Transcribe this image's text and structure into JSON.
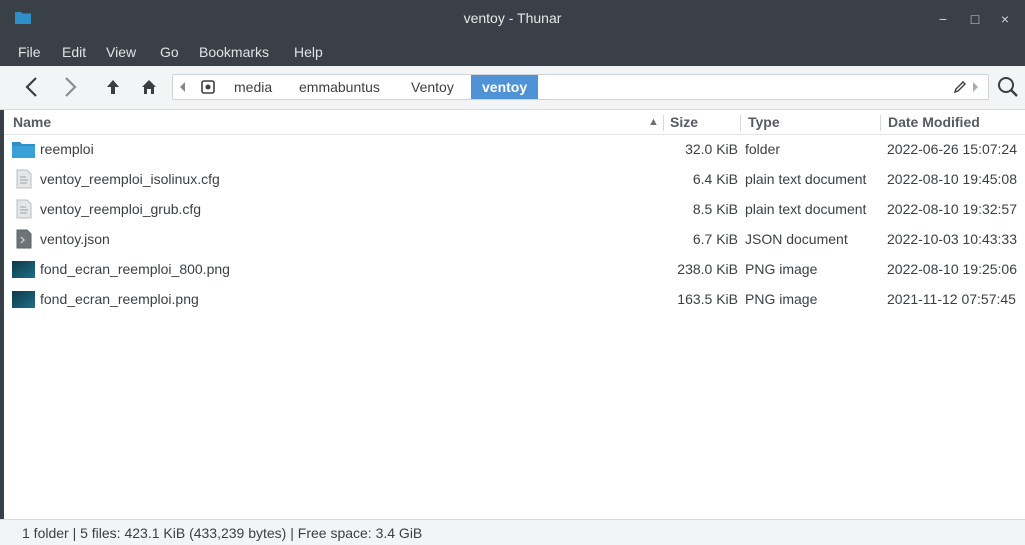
{
  "window": {
    "title": "ventoy - Thunar",
    "minimize_glyph": "−",
    "maximize_glyph": "□",
    "close_glyph": "×"
  },
  "menu": [
    "File",
    "Edit",
    "View",
    "Go",
    "Bookmarks",
    "Help"
  ],
  "toolbar": {
    "icons": [
      "back-arrow-icon",
      "forward-arrow-icon",
      "up-arrow-icon",
      "home-icon",
      "edit-pencil-icon",
      "search-icon"
    ],
    "breadcrumbs": [
      "media",
      "emmabuntus",
      "Ventoy",
      "ventoy"
    ],
    "active_crumb": "ventoy"
  },
  "columns": {
    "name": "Name",
    "size": "Size",
    "type": "Type",
    "date": "Date Modified",
    "sort_indicator": "▲"
  },
  "files": [
    {
      "name": "reemploi",
      "size": "32.0 KiB",
      "type": "folder",
      "date": "2022-06-26 15:07:24",
      "icon": "folder-icon"
    },
    {
      "name": "ventoy_reemploi_isolinux.cfg",
      "size": "6.4 KiB",
      "type": "plain text document",
      "date": "2022-08-10 19:45:08",
      "icon": "text-file-icon"
    },
    {
      "name": "ventoy_reemploi_grub.cfg",
      "size": "8.5 KiB",
      "type": "plain text document",
      "date": "2022-08-10 19:32:57",
      "icon": "text-file-icon"
    },
    {
      "name": "ventoy.json",
      "size": "6.7 KiB",
      "type": "JSON document",
      "date": "2022-10-03 10:43:33",
      "icon": "json-file-icon"
    },
    {
      "name": "fond_ecran_reemploi_800.png",
      "size": "238.0 KiB",
      "type": "PNG image",
      "date": "2022-08-10 19:25:06",
      "icon": "image-thumbnail-icon"
    },
    {
      "name": "fond_ecran_reemploi.png",
      "size": "163.5 KiB",
      "type": "PNG image",
      "date": "2021-11-12 07:57:45",
      "icon": "image-thumbnail-icon"
    }
  ],
  "status": {
    "text": "1 folder  |  5 files: 423.1 KiB (433,239 bytes)  |  Free space: 3.4 GiB"
  },
  "colors": {
    "titlebar": "#3a4047",
    "accent": "#4f93d6",
    "folder": "#2f8fc9"
  }
}
